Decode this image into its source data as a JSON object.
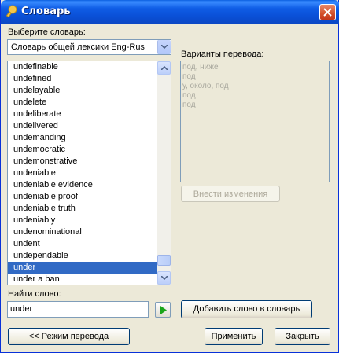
{
  "window": {
    "title": "Словарь"
  },
  "dictionary": {
    "label": "Выберите словарь:",
    "selected": "Словарь общей лексики Eng-Rus"
  },
  "words": [
    "undefinable",
    "undefined",
    "undelayable",
    "undelete",
    "undeliberate",
    "undelivered",
    "undemanding",
    "undemocratic",
    "undemonstrative",
    "undeniable",
    "undeniable evidence",
    "undeniable proof",
    "undeniable truth",
    "undeniably",
    "undenominational",
    "undent",
    "undependable",
    "under",
    "under a ban"
  ],
  "selected_word": "under",
  "translations": {
    "label": "Варианты перевода:",
    "lines": [
      "под, ниже",
      "под",
      "у, около, под",
      "под",
      "под"
    ]
  },
  "buttons": {
    "apply_changes": "Внести изменения",
    "add_word": "Добавить слово в словарь",
    "translate_mode": "<< Режим перевода",
    "apply": "Применить",
    "close": "Закрыть"
  },
  "search": {
    "label": "Найти слово:",
    "value": "under"
  },
  "icons": {
    "app": "dictionary-icon",
    "close": "close-icon",
    "dropdown": "chevron-down-icon",
    "go": "play-icon"
  },
  "colors": {
    "selection": "#316ac5",
    "titlebar": "#0a4fd6",
    "go_arrow": "#1aa51a"
  }
}
